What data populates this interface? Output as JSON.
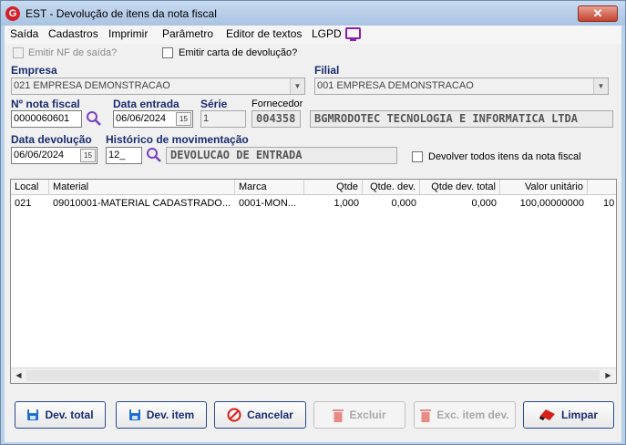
{
  "window": {
    "title": "EST - Devolução de itens da nota fiscal",
    "close": "✕"
  },
  "menu": [
    "Saída",
    "Cadastros",
    "Imprimir",
    "Parâmetro",
    "Editor de textos",
    "LGPD"
  ],
  "options": {
    "emitir_nf": "Emitir NF de saída?",
    "emitir_carta": "Emitir carta de devolução?",
    "devolver_todos": "Devolver todos itens da nota fiscal"
  },
  "empresa": {
    "label": "Empresa",
    "value": "021 EMPRESA DEMONSTRACAO"
  },
  "filial": {
    "label": "Filial",
    "value": "001 EMPRESA DEMONSTRACAO"
  },
  "nota": {
    "label": "Nº nota fiscal",
    "value": "0000060601"
  },
  "data_entrada": {
    "label": "Data entrada",
    "value": "06/06/2024"
  },
  "serie": {
    "label": "Série",
    "value": "1"
  },
  "fornecedor": {
    "label": "Fornecedor",
    "code": "004358",
    "name": "BGMRODOTEC TECNOLOGIA E INFORMATICA LTDA"
  },
  "data_devolucao": {
    "label": "Data devolução",
    "value": "06/06/2024"
  },
  "historico": {
    "label": "Histórico de movimentação",
    "code": "12_",
    "text": "DEVOLUCAO DE ENTRADA"
  },
  "calendar_glyph": "15",
  "grid": {
    "headers": [
      "Local",
      "Material",
      "Marca",
      "Qtde",
      "Qtde. dev.",
      "Qtde dev. total",
      "Valor unitário"
    ],
    "rows": [
      [
        "021",
        "09010001-MATERIAL CADASTRADO...",
        "0001-MON...",
        "1,000",
        "0,000",
        "0,000",
        "100,00000000",
        "10"
      ]
    ]
  },
  "buttons": {
    "dev_total": "Dev. total",
    "dev_item": "Dev. item",
    "cancelar": "Cancelar",
    "excluir": "Excluir",
    "exc_item_dev": "Exc. item dev.",
    "limpar": "Limpar"
  }
}
